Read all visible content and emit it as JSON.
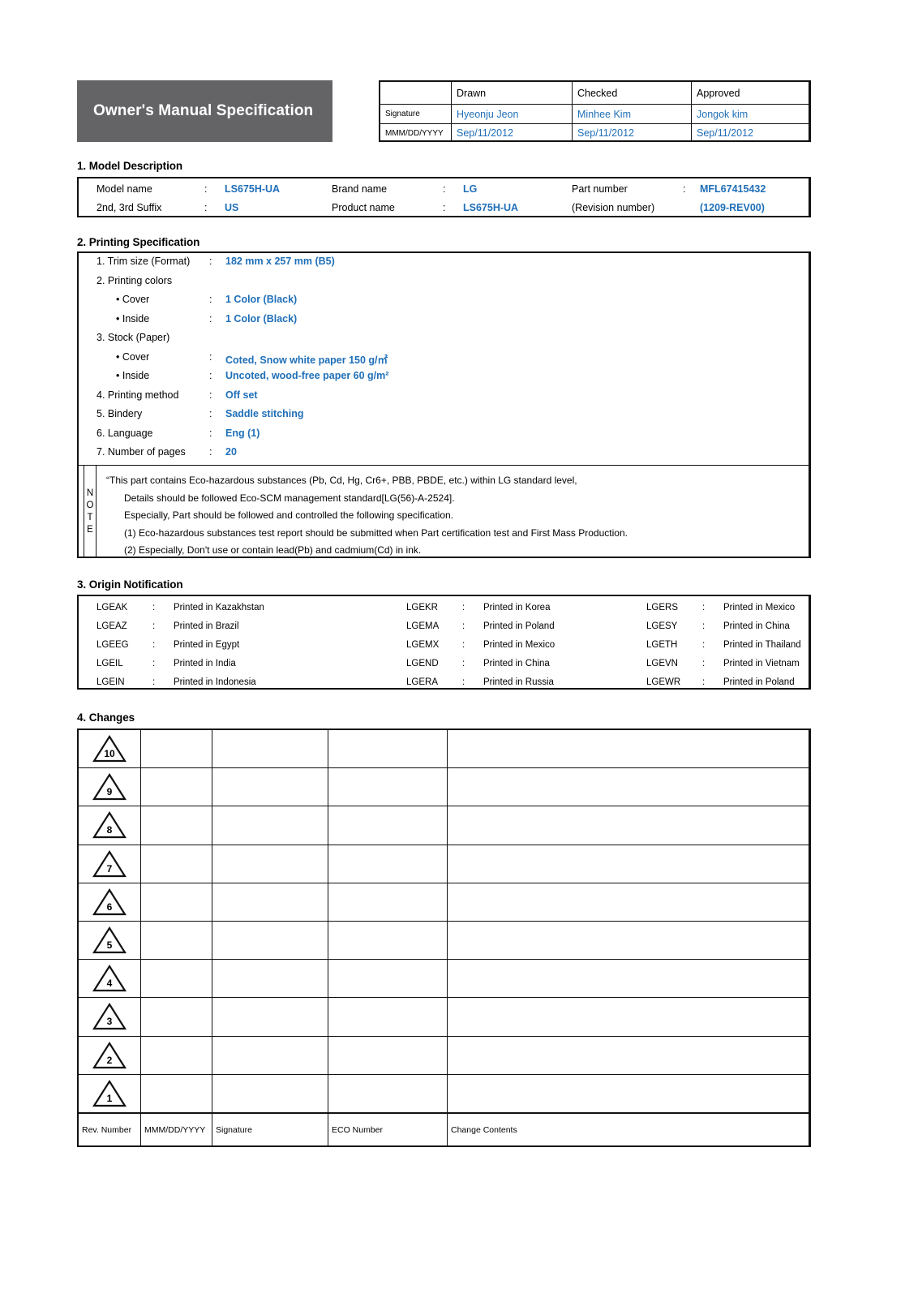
{
  "header": {
    "title": "Owner's Manual Specification",
    "approval_columns": [
      "",
      "Drawn",
      "Checked",
      "Approved"
    ],
    "signature_label": "Signature",
    "date_label": "MMM/DD/YYYY",
    "signatures": [
      "Hyeonju Jeon",
      "Minhee Kim",
      "Jongok kim"
    ],
    "dates": [
      "Sep/11/2012",
      "Sep/11/2012",
      "Sep/11/2012"
    ]
  },
  "sections": {
    "model_description": "1. Model Description",
    "printing_specification": "2. Printing Specification",
    "origin_notification": "3. Origin Notification",
    "changes": "4. Changes"
  },
  "model_description": {
    "row1": {
      "f1_label": "Model name",
      "f1_colon": ":",
      "f1_value": "LS675H-UA",
      "f2_label": "Brand name",
      "f2_colon": ":",
      "f2_value": "LG",
      "f3_label": "Part number",
      "f3_colon": ":",
      "f3_value": "MFL67415432"
    },
    "row2": {
      "f1_label": "2nd, 3rd Suffix",
      "f1_colon": ":",
      "f1_value": "US",
      "f2_label": "Product name",
      "f2_colon": ":",
      "f2_value": "LS675H-UA",
      "f3_label": "(Revision number)",
      "f3_colon": "",
      "f3_value": "(1209-REV00)"
    }
  },
  "printing_specification": {
    "items": [
      {
        "label": "1. Trim size (Format)",
        "colon": ":",
        "value": "182 mm x 257 mm (B5)",
        "sub": false
      },
      {
        "label": "2. Printing colors",
        "colon": "",
        "value": "",
        "sub": false
      },
      {
        "label": "• Cover",
        "colon": ":",
        "value": "1 Color (Black)",
        "sub": true
      },
      {
        "label": "• Inside",
        "colon": ":",
        "value": "1 Color (Black)",
        "sub": true
      },
      {
        "label": "3. Stock (Paper)",
        "colon": "",
        "value": "",
        "sub": false
      },
      {
        "label": "• Cover",
        "colon": ":",
        "value": "Coted, Snow white paper 150 g/㎡",
        "sub": true
      },
      {
        "label": "• Inside",
        "colon": ":",
        "value": "Uncoted, wood-free paper 60 g/m²",
        "sub": true
      },
      {
        "label": "4. Printing method",
        "colon": ":",
        "value": "Off set",
        "sub": false
      },
      {
        "label": "5. Bindery",
        "colon": ":",
        "value": "Saddle stitching",
        "sub": false
      },
      {
        "label": "6. Language",
        "colon": ":",
        "value": "Eng (1)",
        "sub": false
      },
      {
        "label": "7. Number of pages",
        "colon": ":",
        "value": "20",
        "sub": false
      }
    ],
    "note_label_letters": [
      "N",
      "O",
      "T",
      "E"
    ],
    "note_lines": [
      {
        "text": "“This part contains Eco-hazardous substances (Pb, Cd, Hg, Cr6+, PBB, PBDE, etc.) within LG standard level,",
        "indent": false
      },
      {
        "text": "Details should be followed Eco-SCM management standard[LG(56)-A-2524].",
        "indent": true
      },
      {
        "text": "Especially, Part should be followed and controlled the following specification.",
        "indent": true
      },
      {
        "text": "(1) Eco-hazardous substances test report should be submitted when Part certification test and First Mass Production.",
        "indent": true
      },
      {
        "text": "(2) Especially, Don't use or contain lead(Pb) and cadmium(Cd) in ink.",
        "indent": true
      }
    ]
  },
  "origin_notification": {
    "colon": ":",
    "rows": [
      [
        {
          "code": "LGEAK",
          "text": "Printed in Kazakhstan"
        },
        {
          "code": "LGEKR",
          "text": "Printed in Korea"
        },
        {
          "code": "LGERS",
          "text": "Printed in Mexico"
        }
      ],
      [
        {
          "code": "LGEAZ",
          "text": "Printed in Brazil"
        },
        {
          "code": "LGEMA",
          "text": "Printed in Poland"
        },
        {
          "code": "LGESY",
          "text": "Printed in China"
        }
      ],
      [
        {
          "code": "LGEEG",
          "text": "Printed in Egypt"
        },
        {
          "code": "LGEMX",
          "text": "Printed in Mexico"
        },
        {
          "code": "LGETH",
          "text": "Printed in Thailand"
        }
      ],
      [
        {
          "code": "LGEIL",
          "text": "Printed in India"
        },
        {
          "code": "LGEND",
          "text": "Printed in China"
        },
        {
          "code": "LGEVN",
          "text": "Printed in Vietnam"
        }
      ],
      [
        {
          "code": "LGEIN",
          "text": "Printed in Indonesia"
        },
        {
          "code": "LGERA",
          "text": "Printed in Russia"
        },
        {
          "code": "LGEWR",
          "text": "Printed in Poland"
        }
      ]
    ]
  },
  "changes": {
    "rev_numbers": [
      "10",
      "9",
      "8",
      "7",
      "6",
      "5",
      "4",
      "3",
      "2",
      "1"
    ],
    "rows": [
      {
        "date": "",
        "signature": "",
        "eco": "",
        "contents": ""
      },
      {
        "date": "",
        "signature": "",
        "eco": "",
        "contents": ""
      },
      {
        "date": "",
        "signature": "",
        "eco": "",
        "contents": ""
      },
      {
        "date": "",
        "signature": "",
        "eco": "",
        "contents": ""
      },
      {
        "date": "",
        "signature": "",
        "eco": "",
        "contents": ""
      },
      {
        "date": "",
        "signature": "",
        "eco": "",
        "contents": ""
      },
      {
        "date": "",
        "signature": "",
        "eco": "",
        "contents": ""
      },
      {
        "date": "",
        "signature": "",
        "eco": "",
        "contents": ""
      },
      {
        "date": "",
        "signature": "",
        "eco": "",
        "contents": ""
      },
      {
        "date": "",
        "signature": "",
        "eco": "",
        "contents": ""
      }
    ],
    "footer": [
      "Rev. Number",
      "MMM/DD/YYYY",
      "Signature",
      "ECO Number",
      "Change Contents"
    ]
  },
  "colors": {
    "value_blue": "#1f6fb8",
    "title_gray": "#646467",
    "rule_black": "#111111"
  }
}
